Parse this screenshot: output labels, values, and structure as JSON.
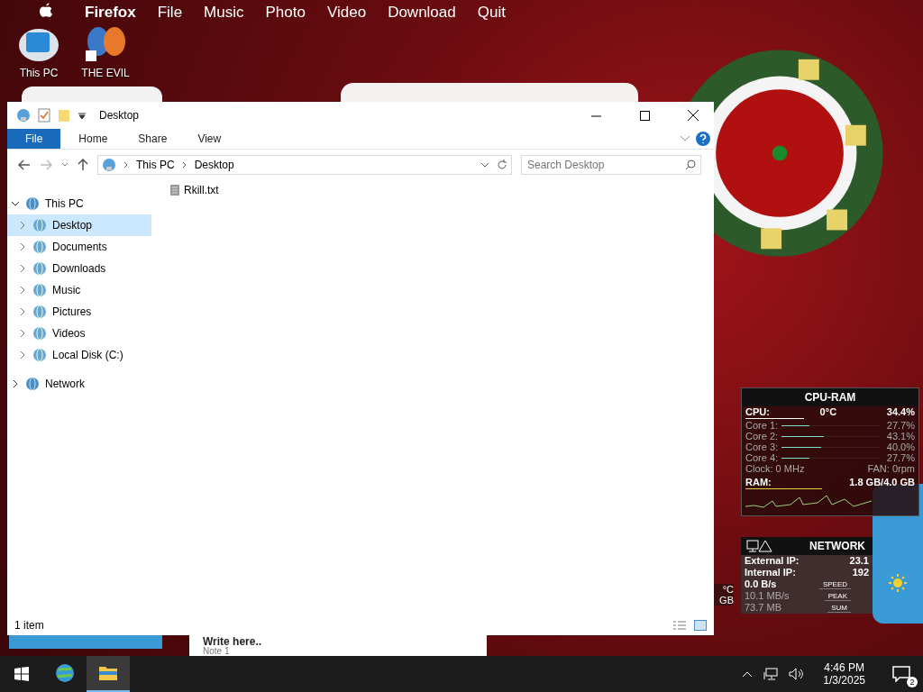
{
  "menu_bar": {
    "app": "Firefox",
    "items": [
      "File",
      "Music",
      "Photo",
      "Video",
      "Download",
      "Quit"
    ]
  },
  "desktop_icons": [
    {
      "label": "This PC",
      "kind": "pc"
    },
    {
      "label": "THE EVIL",
      "kind": "shortcut"
    }
  ],
  "explorer": {
    "title": "Desktop",
    "ribbon_tabs": [
      {
        "label": "File",
        "selected": true
      },
      {
        "label": "Home",
        "selected": false
      },
      {
        "label": "Share",
        "selected": false
      },
      {
        "label": "View",
        "selected": false
      }
    ],
    "address": [
      "This PC",
      "Desktop"
    ],
    "search": {
      "placeholder": "Search Desktop"
    },
    "nav_tree": [
      {
        "label": "This PC",
        "expanded": true,
        "selected": false,
        "children": [
          {
            "label": "Desktop",
            "expanded": false,
            "selected": true
          },
          {
            "label": "Documents",
            "expanded": false,
            "selected": false
          },
          {
            "label": "Downloads",
            "expanded": false,
            "selected": false
          },
          {
            "label": "Music",
            "expanded": false,
            "selected": false
          },
          {
            "label": "Pictures",
            "expanded": false,
            "selected": false
          },
          {
            "label": "Videos",
            "expanded": false,
            "selected": false
          },
          {
            "label": "Local Disk (C:)",
            "expanded": false,
            "selected": false
          }
        ]
      },
      {
        "label": "Network",
        "expanded": false,
        "selected": false
      }
    ],
    "files": [
      {
        "name": "Rkill.txt"
      }
    ],
    "status": "1 item"
  },
  "notes_widget": {
    "text": "Write here..",
    "note": "Note 1"
  },
  "side_widget": {
    "temp": "°C",
    "ram": "GB"
  },
  "cpu_ram": {
    "title": "CPU-RAM",
    "cpu_label": "CPU:",
    "cpu_temp": "0°C",
    "cpu_load": "34.4%",
    "level": 0.344,
    "cores": [
      {
        "label": "Core 1:",
        "reading": "27.7%",
        "level": 0.277
      },
      {
        "label": "Core 2:",
        "reading": "43.1%",
        "level": 0.431
      },
      {
        "label": "Core 3:",
        "reading": "40.0%",
        "level": 0.4
      },
      {
        "label": "Core 4:",
        "reading": "27.7%",
        "level": 0.277
      }
    ],
    "clock": "Clock: 0 MHz",
    "fan": "FAN: 0rpm",
    "ram": {
      "label": "RAM:",
      "reading": "1.8 GB/4.0 GB",
      "level": 0.45
    }
  },
  "network": {
    "title": "NETWORK",
    "rows": [
      {
        "label": "External IP:",
        "value": "23.1"
      },
      {
        "label": "Internal IP:",
        "value": "192"
      }
    ],
    "stats": [
      {
        "value": "0.0 B/s",
        "button": "SPEED"
      },
      {
        "value": "10.1 MB/s",
        "button": "PEAK"
      },
      {
        "value": "73.7 MB",
        "button": "SUM"
      }
    ]
  },
  "taskbar": {
    "apps": [
      {
        "kind": "browser",
        "selected": false
      },
      {
        "kind": "folder",
        "selected": true
      }
    ],
    "time": "4:46 PM",
    "date": "1/3/2025",
    "notifications": "2"
  }
}
